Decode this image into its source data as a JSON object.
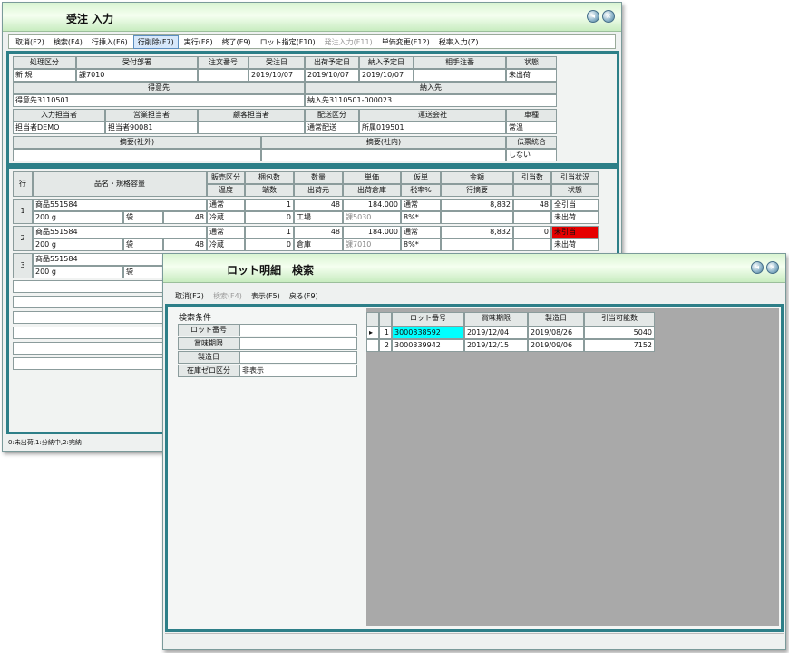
{
  "order": {
    "title": "受注 入力",
    "menu": [
      "取消(F2)",
      "検索(F4)",
      "行挿入(F6)",
      "行削除(F7)",
      "実行(F8)",
      "終了(F9)",
      "ロット指定(F10)",
      "発注入力(F11)",
      "単価変更(F12)",
      "税率入力(Z)"
    ],
    "header_labels": {
      "kubun": "処理区分",
      "dept": "受付部署",
      "chumon": "注文番号",
      "juchubi": "受注日",
      "shukka": "出荷予定日",
      "nonyu": "納入予定日",
      "aite": "相手注番",
      "jotai": "状態",
      "tokui": "得意先",
      "nonyusaki": "納入先",
      "nyuryoku": "入力担当者",
      "eigyo": "営業担当者",
      "kokyaku": "顧客担当者",
      "haisou": "配送区分",
      "unsou": "運送会社",
      "shashu": "車種",
      "tekiyo_out": "摘要(社外)",
      "tekiyo_in": "摘要(社内)",
      "denpyo": "伝票統合"
    },
    "header_values": {
      "kubun": "新 規",
      "dept": "課7010",
      "juchubi": "2019/10/07",
      "shukka": "2019/10/07",
      "nonyu": "2019/10/07",
      "jotai": "未出荷",
      "tokui": "得意先3110501",
      "nonyusaki": "納入先3110501-000023",
      "nyuryoku": "担当者DEMO",
      "eigyo": "担当者90081",
      "haisou": "通常配送",
      "unsou": "所属019501",
      "shashu": "常温",
      "denpyo": "しない"
    },
    "grid_headers": {
      "row": "行",
      "name": "品名・規格容量",
      "hanbai": "販売区分",
      "ondo": "温度",
      "konpo": "梱包数",
      "hasu": "端数",
      "suryo": "数量",
      "shukkamoto": "出荷元",
      "tanka": "単価",
      "soko": "出荷倉庫",
      "kakaku": "仮単",
      "zeiritsu": "税率%",
      "kingaku": "金額",
      "gyo": "行摘要",
      "hikiate": "引当数",
      "hikiate_jokyo": "引当状況",
      "jotai": "状態"
    },
    "rows": [
      {
        "no": "1",
        "name": "商品551584",
        "qty_label": "200 g",
        "unit": "袋",
        "unit_qty": "48",
        "hanbai": "通常",
        "ondo": "冷蔵",
        "konpo": "1",
        "hasu": "0",
        "suryo": "48",
        "shukkamoto": "工場",
        "tanka": "184.000",
        "soko": "課5030",
        "kakaku": "通常",
        "zei": "8%*",
        "kingaku": "8,832",
        "hikiate": "48",
        "jokyo": "全引当",
        "jotai": "未出荷"
      },
      {
        "no": "2",
        "name": "商品551584",
        "qty_label": "200 g",
        "unit": "袋",
        "unit_qty": "48",
        "hanbai": "通常",
        "ondo": "冷蔵",
        "konpo": "1",
        "hasu": "0",
        "suryo": "48",
        "shukkamoto": "倉庫",
        "tanka": "184.000",
        "soko": "課7010",
        "kakaku": "通常",
        "zei": "8%*",
        "kingaku": "8,832",
        "hikiate": "0",
        "jokyo": "未引当",
        "jotai": "未出荷"
      },
      {
        "no": "3",
        "name": "商品551584",
        "qty_label": "200 g",
        "unit": "袋"
      }
    ],
    "status": "0:未出荷,1:分納中,2:完納"
  },
  "lot": {
    "title": "ロット明細　検索",
    "menu": [
      "取消(F2)",
      "検索(F4)",
      "表示(F5)",
      "戻る(F9)"
    ],
    "cond_title": "検索条件",
    "conds": [
      {
        "label": "ロット番号",
        "value": ""
      },
      {
        "label": "賞味期限",
        "value": ""
      },
      {
        "label": "製造日",
        "value": ""
      },
      {
        "label": "在庫ゼロ区分",
        "value": "非表示"
      }
    ],
    "cols": [
      "ロット番号",
      "賞味期限",
      "製造日",
      "引当可能数"
    ],
    "rows": [
      {
        "no": "1",
        "lot": "3000338592",
        "exp": "2019/12/04",
        "made": "2019/08/26",
        "qty": "5040"
      },
      {
        "no": "2",
        "lot": "3000339942",
        "exp": "2019/12/15",
        "made": "2019/09/06",
        "qty": "7152"
      }
    ]
  }
}
